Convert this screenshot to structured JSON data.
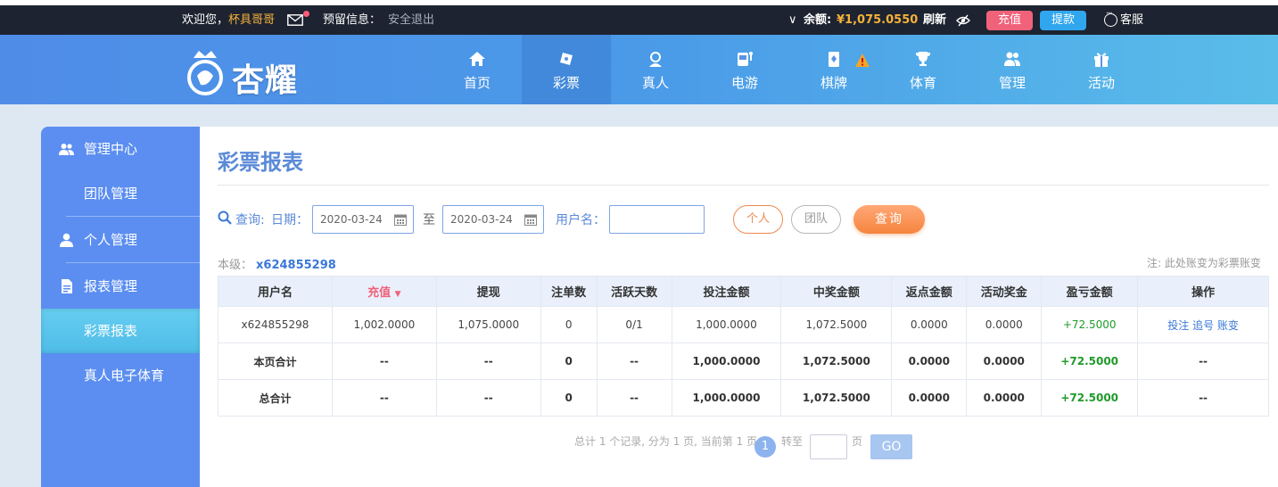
{
  "topbar": {
    "welcome": "欢迎您，",
    "nickname": "杯具哥哥",
    "notice_label": "预留信息：",
    "logout": "安全退出",
    "balance_label": "余额:",
    "balance_value": "¥1,075.0550",
    "refresh": "刷新",
    "recharge": "充值",
    "withdraw": "提款",
    "customer_service": "客服"
  },
  "logo": {
    "text": "杏耀"
  },
  "nav": [
    {
      "label": "首页",
      "icon": "home-icon"
    },
    {
      "label": "彩票",
      "icon": "lottery-icon",
      "active": true
    },
    {
      "label": "真人",
      "icon": "live-dealer-icon"
    },
    {
      "label": "电游",
      "icon": "slot-machine-icon"
    },
    {
      "label": "棋牌",
      "icon": "cards-icon"
    },
    {
      "label": "体育",
      "icon": "trophy-icon"
    },
    {
      "label": "管理",
      "icon": "users-icon"
    },
    {
      "label": "活动",
      "icon": "gift-icon"
    }
  ],
  "sidebar": {
    "groups": [
      {
        "label": "管理中心",
        "icon": "team-icon"
      },
      {
        "label": "团队管理"
      },
      {
        "label": "个人管理",
        "icon": "person-icon"
      },
      {
        "label": "报表管理",
        "icon": "report-icon"
      },
      {
        "label": "彩票报表",
        "active": true
      },
      {
        "label": "真人电子体育"
      }
    ]
  },
  "main": {
    "title": "彩票报表",
    "query": {
      "label": "查询:",
      "date_label": "日期：",
      "date_from": "2020-03-24",
      "to": "至",
      "date_to": "2020-03-24",
      "username_label": "用户名：",
      "username_value": "",
      "btn_personal": "个人",
      "btn_team": "团队",
      "btn_query": "查询"
    },
    "level_label": "本级：",
    "level_user": "x624855298",
    "note": "注: 此处账变为彩票账变",
    "table": {
      "headers": [
        "用户名",
        "充值",
        "提现",
        "注单数",
        "活跃天数",
        "投注金额",
        "中奖金额",
        "返点金额",
        "活动奖金",
        "盈亏金额",
        "操作"
      ],
      "sort_column": "充值",
      "rows": [
        {
          "user": "x624855298",
          "recharge": "1,002.0000",
          "withdraw": "1,075.0000",
          "orders": "0",
          "active_days": "0/1",
          "bet": "1,000.0000",
          "win": "1,072.5000",
          "rebate": "0.0000",
          "bonus": "0.0000",
          "profit": "+72.5000",
          "actions": [
            "投注",
            "追号",
            "账变"
          ]
        }
      ],
      "page_total": {
        "label": "本页合计",
        "recharge": "--",
        "withdraw": "--",
        "orders": "0",
        "active_days": "--",
        "bet": "1,000.0000",
        "win": "1,072.5000",
        "rebate": "0.0000",
        "bonus": "0.0000",
        "profit": "+72.5000",
        "actions": "--"
      },
      "grand_total": {
        "label": "总合计",
        "recharge": "--",
        "withdraw": "--",
        "orders": "0",
        "active_days": "--",
        "bet": "1,000.0000",
        "win": "1,072.5000",
        "rebate": "0.0000",
        "bonus": "0.0000",
        "profit": "+72.5000",
        "actions": "--"
      }
    },
    "pager": {
      "summary": "总计 1 个记录, 分为 1 页, 当前第 1 页",
      "current_page": "1",
      "goto_label": "转至",
      "page_unit": "页",
      "go": "GO"
    }
  },
  "colors": {
    "accent": "#5b8ef0",
    "profit_green": "#1f9a2a",
    "balance_gold": "#f6b13a",
    "query_orange": "#f5843e"
  }
}
